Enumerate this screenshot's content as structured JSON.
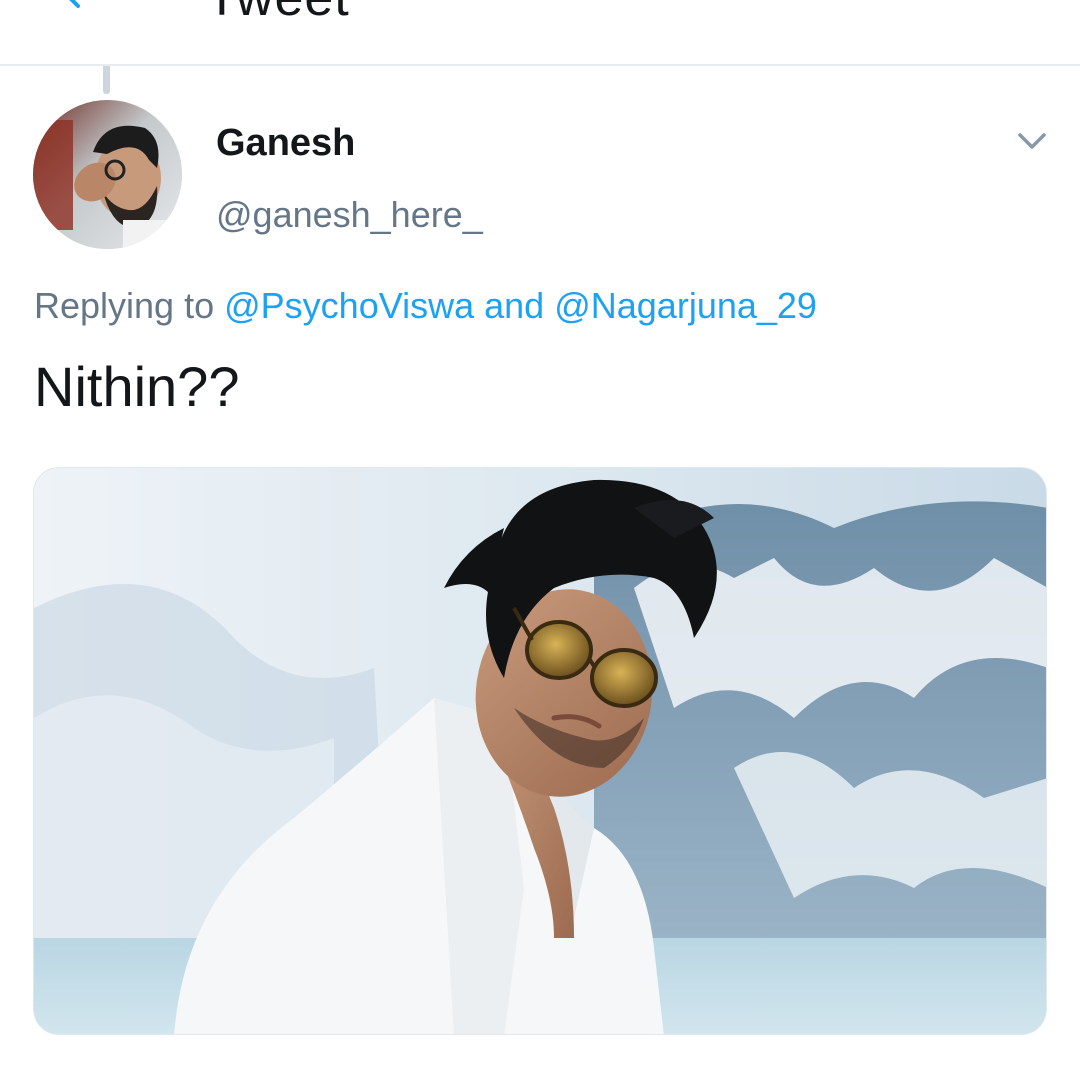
{
  "header": {
    "title": "Tweet",
    "back_icon": "back-arrow-icon",
    "accent": "#1da1f2"
  },
  "tweet": {
    "display_name": "Ganesh",
    "handle": "@ganesh_here_",
    "reply_prefix": "Replying to",
    "reply_mention_1": "@PsychoViswa",
    "reply_and": "and",
    "reply_mention_2": "@Nagarjuna_29",
    "text": "Nithin??",
    "menu_icon": "chevron-down-icon",
    "media": "photo of a man in white suit and aviator sunglasses against snowy mountains"
  },
  "colors": {
    "text_primary": "#14171a",
    "text_secondary": "#657786",
    "link": "#1da1f2",
    "divider": "#e6ecf0"
  }
}
